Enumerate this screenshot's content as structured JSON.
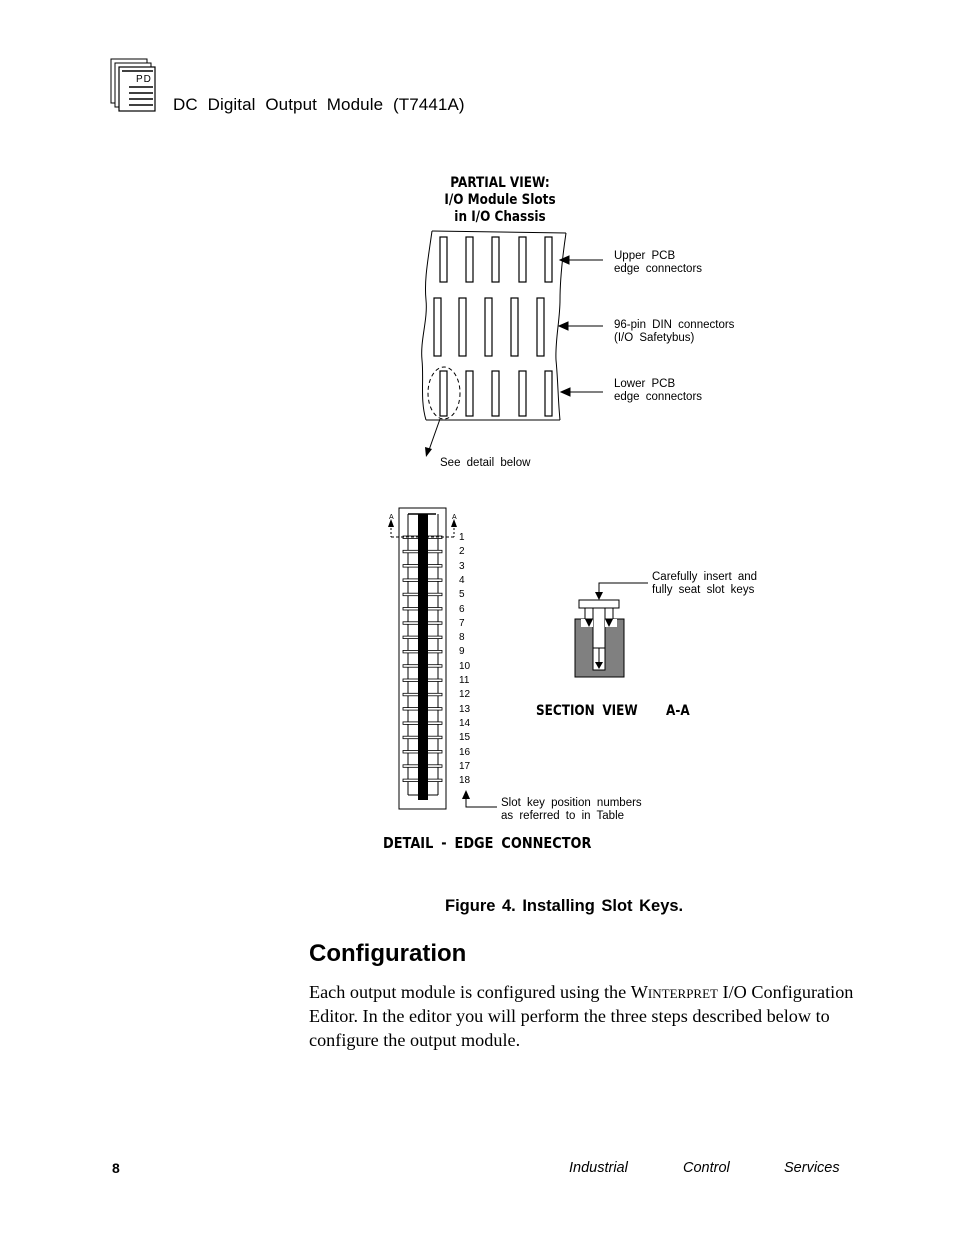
{
  "header": {
    "logo_text": "PD",
    "title": "DC Digital Output Module (T7441A)"
  },
  "figure": {
    "partial_view_title": [
      "PARTIAL VIEW:",
      "I/O Module Slots",
      "in I/O Chassis"
    ],
    "callouts": {
      "upper": [
        "Upper PCB",
        "edge connectors"
      ],
      "din": [
        "96-pin DIN connectors",
        "(I/O Safetybus)"
      ],
      "lower": [
        "Lower PCB",
        "edge connectors"
      ],
      "see_detail": "See detail below",
      "slot_key": [
        "Carefully insert and",
        "fully seat slot keys"
      ],
      "position_numbers": [
        "Slot key position numbers",
        "as referred to in Table"
      ]
    },
    "section_marker": "A",
    "pin_numbers": [
      "1",
      "2",
      "3",
      "4",
      "5",
      "6",
      "7",
      "8",
      "9",
      "10",
      "11",
      "12",
      "13",
      "14",
      "15",
      "16",
      "17",
      "18"
    ],
    "section_view_title": "SECTION VIEW",
    "section_view_id": "A-A",
    "detail_title": "DETAIL - EDGE CONNECTOR",
    "caption": "Figure 4.  Installing Slot Keys."
  },
  "section": {
    "heading": "Configuration",
    "paragraph_before": "Each output module is configured using the ",
    "product_name": "Winterpret",
    "paragraph_after": " I/O Configuration Editor.  In the editor you will perform the three steps described below to configure the output module."
  },
  "footer": {
    "page_number": "8",
    "brand_words": [
      "Industrial",
      "Control",
      "Services"
    ]
  },
  "colors": {
    "ink": "#000000",
    "section_fill": "#808080"
  }
}
